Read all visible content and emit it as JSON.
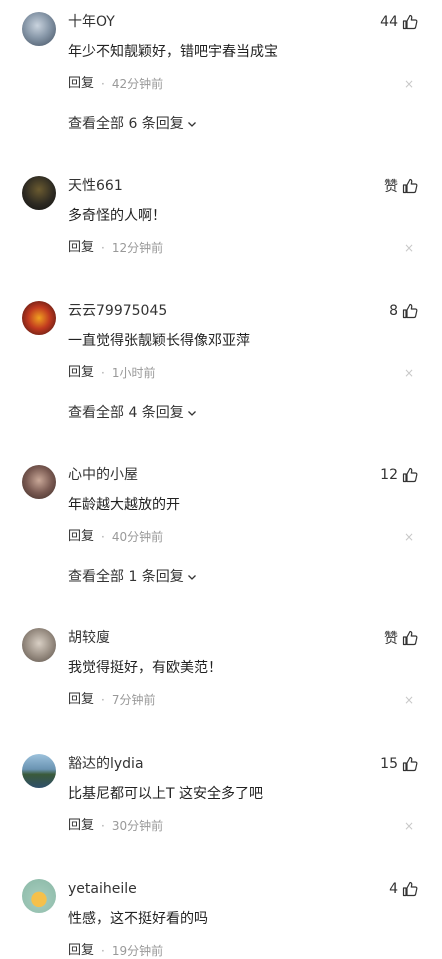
{
  "labels": {
    "reply": "回复",
    "dot": "·",
    "close": "×"
  },
  "comments": [
    {
      "username": "十年OY",
      "likes": "44",
      "text": "年少不知靓颖好，错吧宇春当成宝",
      "time": "42分钟前",
      "view_replies": "查看全部 6 条回复",
      "avatar_color": "#6e7f93"
    },
    {
      "username": "天性661",
      "likes": "赞",
      "text": "多奇怪的人啊！",
      "time": "12分钟前",
      "avatar_color": "#2d2a22"
    },
    {
      "username": "云云79975045",
      "likes": "8",
      "text": "一直觉得张靓颖长得像邓亚萍",
      "time": "1小时前",
      "view_replies": "查看全部 4 条回复",
      "avatar_color": "#c0391f"
    },
    {
      "username": "心中的小屋",
      "likes": "12",
      "text": "年龄越大越放的开",
      "time": "40分钟前",
      "view_replies": "查看全部 1 条回复",
      "avatar_color": "#7a5a52"
    },
    {
      "username": "胡较廋",
      "likes": "赞",
      "text": "我觉得挺好，有欧美范！",
      "time": "7分钟前",
      "avatar_color": "#9a8f84"
    },
    {
      "username": "豁达的lydia",
      "likes": "15",
      "text": "比基尼都可以上T 这安全多了吧",
      "time": "30分钟前",
      "avatar_color": "#4f7896"
    },
    {
      "username": "yetaiheile",
      "likes": "4",
      "text": "性感，这不挺好看的吗",
      "time": "19分钟前",
      "avatar_color": "#9ec7b7"
    }
  ]
}
